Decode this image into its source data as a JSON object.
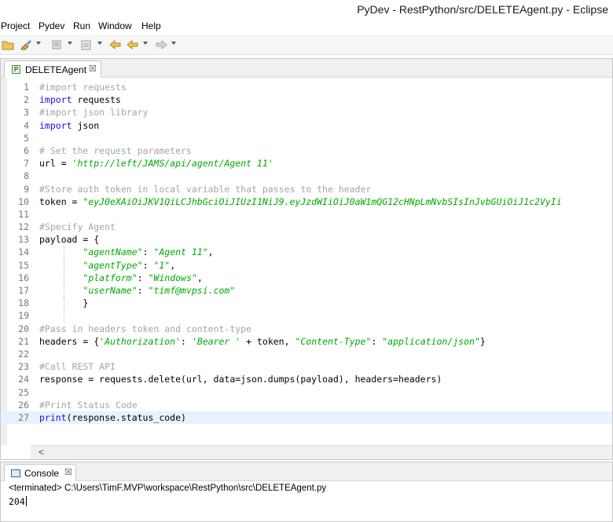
{
  "window": {
    "title": "PyDev - RestPython/src/DELETEAgent.py - Eclipse"
  },
  "menu": {
    "items": [
      "Project",
      "Pydev",
      "Run",
      "Window",
      "Help"
    ]
  },
  "editor": {
    "tab_label": "DELETEAgent",
    "tab_close": "☒",
    "current_line": 27,
    "lines": [
      {
        "n": "1",
        "segs": [
          [
            "c",
            "#import requests"
          ]
        ]
      },
      {
        "n": "2",
        "segs": [
          [
            "k",
            "import"
          ],
          [
            "t",
            " requests"
          ]
        ]
      },
      {
        "n": "3",
        "segs": [
          [
            "c",
            "#import json library"
          ]
        ]
      },
      {
        "n": "4",
        "segs": [
          [
            "k",
            "import"
          ],
          [
            "t",
            " json"
          ]
        ]
      },
      {
        "n": "5",
        "segs": []
      },
      {
        "n": "6",
        "segs": [
          [
            "c",
            "# Set the request parameters"
          ]
        ]
      },
      {
        "n": "7",
        "segs": [
          [
            "t",
            "url = "
          ],
          [
            "s",
            "'http://left/JAMS/api/agent/Agent 11'"
          ]
        ]
      },
      {
        "n": "8",
        "segs": []
      },
      {
        "n": "9",
        "segs": [
          [
            "c",
            "#Store auth token in local variable that passes to the header"
          ]
        ]
      },
      {
        "n": "10",
        "segs": [
          [
            "t",
            "token = "
          ],
          [
            "s",
            "\"eyJ0eXAiOiJKV1QiLCJhbGciOiJIUzI1NiJ9.eyJzdWIiOiJ0aW1mQG12cHNpLmNvbSIsInJvbGUiOiJ1c2VyIi"
          ]
        ]
      },
      {
        "n": "11",
        "segs": []
      },
      {
        "n": "12",
        "segs": [
          [
            "c",
            "#Specify Agent"
          ]
        ]
      },
      {
        "n": "13",
        "segs": [
          [
            "t",
            "payload = {"
          ]
        ]
      },
      {
        "n": "14",
        "indent": true,
        "segs": [
          [
            "t",
            "        "
          ],
          [
            "s",
            "\"agentName\""
          ],
          [
            "t",
            ": "
          ],
          [
            "s",
            "\"Agent 11\""
          ],
          [
            "t",
            ","
          ]
        ]
      },
      {
        "n": "15",
        "indent": true,
        "segs": [
          [
            "t",
            "        "
          ],
          [
            "s",
            "\"agentType\""
          ],
          [
            "t",
            ": "
          ],
          [
            "s",
            "\"1\""
          ],
          [
            "t",
            ","
          ]
        ]
      },
      {
        "n": "16",
        "indent": true,
        "segs": [
          [
            "t",
            "        "
          ],
          [
            "s",
            "\"platform\""
          ],
          [
            "t",
            ": "
          ],
          [
            "s",
            "\"Windows\""
          ],
          [
            "t",
            ","
          ]
        ]
      },
      {
        "n": "17",
        "indent": true,
        "segs": [
          [
            "t",
            "        "
          ],
          [
            "s",
            "\"userName\""
          ],
          [
            "t",
            ": "
          ],
          [
            "s",
            "\"timf@mvpsi.com\""
          ]
        ]
      },
      {
        "n": "18",
        "indent": true,
        "segs": [
          [
            "t",
            "        }"
          ]
        ]
      },
      {
        "n": "19",
        "indent": true,
        "segs": []
      },
      {
        "n": "20",
        "segs": [
          [
            "c",
            "#Pass in headers token and content-type"
          ]
        ]
      },
      {
        "n": "21",
        "segs": [
          [
            "t",
            "headers = {"
          ],
          [
            "s",
            "'Authorization'"
          ],
          [
            "t",
            ": "
          ],
          [
            "s",
            "'Bearer '"
          ],
          [
            "t",
            " + token, "
          ],
          [
            "s",
            "\"Content-Type\""
          ],
          [
            "t",
            ": "
          ],
          [
            "s",
            "\"application/json\""
          ],
          [
            "t",
            "}"
          ]
        ]
      },
      {
        "n": "22",
        "segs": []
      },
      {
        "n": "23",
        "segs": [
          [
            "c",
            "#Call REST API"
          ]
        ]
      },
      {
        "n": "24",
        "segs": [
          [
            "t",
            "response = requests.delete(url, data=json.dumps(payload), headers=headers)"
          ]
        ]
      },
      {
        "n": "25",
        "segs": []
      },
      {
        "n": "26",
        "segs": [
          [
            "c",
            "#Print Status Code"
          ]
        ]
      },
      {
        "n": "27",
        "segs": [
          [
            "k",
            "print"
          ],
          [
            "t",
            "(response.status_code)"
          ]
        ]
      }
    ]
  },
  "scrollbar": {
    "left_arrow": "<"
  },
  "console": {
    "tab_label": "Console",
    "tab_close": "☒",
    "status": "<terminated> C:\\Users\\TimF.MVP\\workspace\\RestPython\\src\\DELETEAgent.py",
    "output": "204"
  },
  "icons": [
    "open-folder-icon",
    "brush-icon",
    "debug-icon",
    "run-config-icon",
    "back-arrow-icon",
    "forward-arrow-icon",
    "python-file-icon",
    "console-monitor-icon"
  ]
}
